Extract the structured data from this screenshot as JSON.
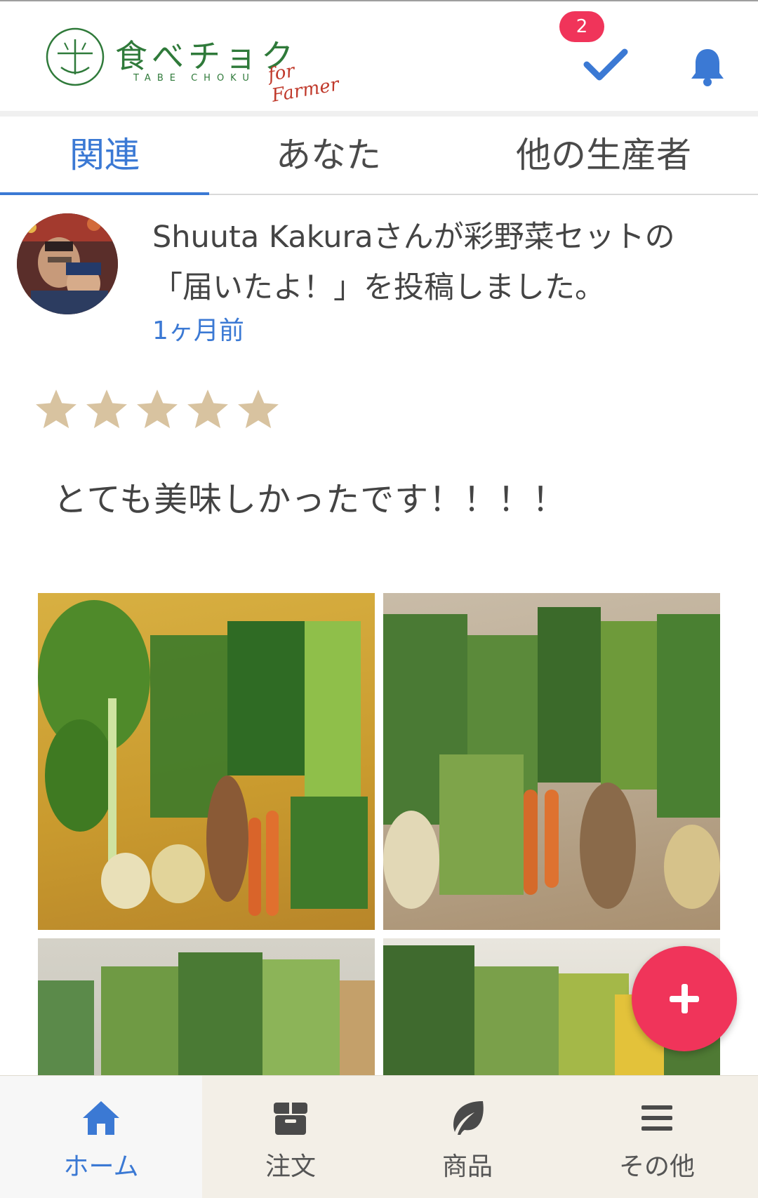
{
  "header": {
    "logo_text": "食べチョク",
    "logo_sub": "TABE CHOKU",
    "logo_farmer": "for Farmer",
    "notification_badge": "2",
    "check_icon": "check-icon",
    "bell_icon": "bell-icon"
  },
  "tabs": [
    {
      "label": "関連",
      "active": true
    },
    {
      "label": "あなた",
      "active": false
    },
    {
      "label": "他の生産者",
      "active": false
    }
  ],
  "post": {
    "line1": "Shuuta Kakuraさんが彩野菜セットの",
    "line2": "「届いたよ！」を投稿しました。",
    "time": "1ヶ月前",
    "rating": 5,
    "rating_max": 5,
    "comment": "とても美味しかったです！！！！"
  },
  "fab": {
    "icon": "plus-icon"
  },
  "bottom_nav": [
    {
      "label": "ホーム",
      "icon": "home-icon",
      "active": true
    },
    {
      "label": "注文",
      "icon": "box-icon",
      "active": false
    },
    {
      "label": "商品",
      "icon": "leaf-icon",
      "active": false
    },
    {
      "label": "その他",
      "icon": "menu-icon",
      "active": false
    }
  ],
  "colors": {
    "accent_blue": "#3b79d4",
    "badge_pink": "#f0345a",
    "star_tan": "#d8c3a0",
    "logo_green": "#2f7a3a",
    "nav_bg": "#f3efe7"
  }
}
